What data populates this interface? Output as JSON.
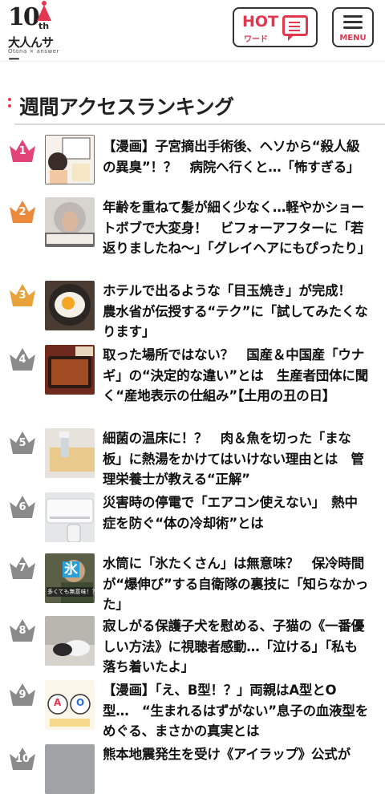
{
  "header": {
    "logo": {
      "number": "10",
      "suffix": "th",
      "brand": "大人んサー",
      "sub": "Otona × answer"
    },
    "hot_button": {
      "title": "HOT",
      "subtitle": "ワード"
    },
    "menu_button": {
      "label": "MENU"
    }
  },
  "section": {
    "title": "週間アクセスランキング"
  },
  "colors": {
    "accent": "#e2374f",
    "gold": "#e8a23a",
    "orange": "#ec8a3c",
    "pink": "#e2447a",
    "gray": "#8a8a8a"
  },
  "ranking": [
    {
      "rank": "1",
      "title": "【漫画】子宮摘出手術後、ヘソから“殺人級の異臭”！？　病院へ行くと…「怖すぎる」",
      "thumb": "manga"
    },
    {
      "rank": "2",
      "title": "年齢を重ねて髪が細く少なく…軽やかショートボブで大変身！　ビフォーアフターに「若返りましたね〜」「グレイヘアにもぴったり」",
      "thumb": "hair"
    },
    {
      "rank": "3",
      "title": "ホテルで出るような「目玉焼き」が完成！　農水省が伝授する“テク”に「試してみたくなります」",
      "thumb": "egg"
    },
    {
      "rank": "4",
      "title": "取った場所ではない？　国産＆中国産「ウナギ」の“決定的な違い”とは　生産者団体に聞く“産地表示の仕組み”【土用の丑の日】",
      "thumb": "eel"
    },
    {
      "rank": "5",
      "title": "細菌の温床に！？　肉＆魚を切った「まな板」に熱湯をかけてはいけない理由とは　管理栄養士が教える“正解”",
      "thumb": "board"
    },
    {
      "rank": "6",
      "title": "災害時の停電で「エアコン使えない」　熱中症を防ぐ“体の冷却術”とは",
      "thumb": "aircon"
    },
    {
      "rank": "7",
      "title": "水筒に「氷たくさん」は無意味？　保冷時間が“爆伸び”する自衛隊の裏技に「知らなかった」",
      "thumb": "ice",
      "thumb_text": "氷",
      "thumb_caption": "多くても無意味！？"
    },
    {
      "rank": "8",
      "title": "寂しがる保護子犬を慰める、子猫の《一番優しい方法》に視聴者感動…「泣ける」「私も落ち着いたよ」",
      "thumb": "pets"
    },
    {
      "rank": "9",
      "title": "【漫画】「え、B型！？」両親はA型とO型…　“生まれるはずがない”息子の血液型をめぐる、まさかの真実とは",
      "thumb": "blood",
      "thumb_a": "A",
      "thumb_o": "O"
    },
    {
      "rank": "10",
      "title": "熊本地震発生を受け《アイラップ》公式が",
      "thumb": "gray"
    }
  ]
}
